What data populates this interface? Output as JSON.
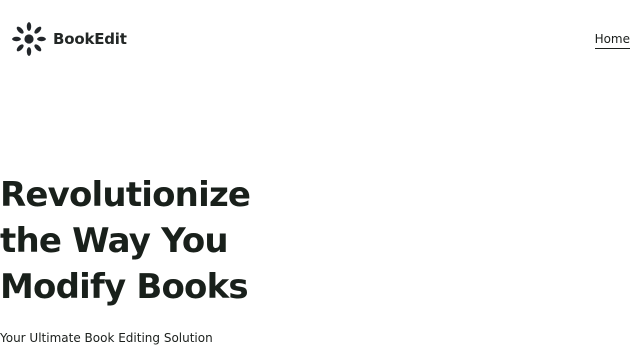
{
  "brand": {
    "name": "BookEdit",
    "logo_icon": "sunburst-logo-icon"
  },
  "nav": {
    "items": [
      {
        "label": "Home"
      }
    ]
  },
  "hero": {
    "title_lines": [
      "Revolutionize",
      "the Way You",
      "Modify Books"
    ],
    "subtitle": "Your Ultimate Book Editing Solution"
  },
  "colors": {
    "text": "#1b1f1c",
    "background": "#ffffff"
  }
}
